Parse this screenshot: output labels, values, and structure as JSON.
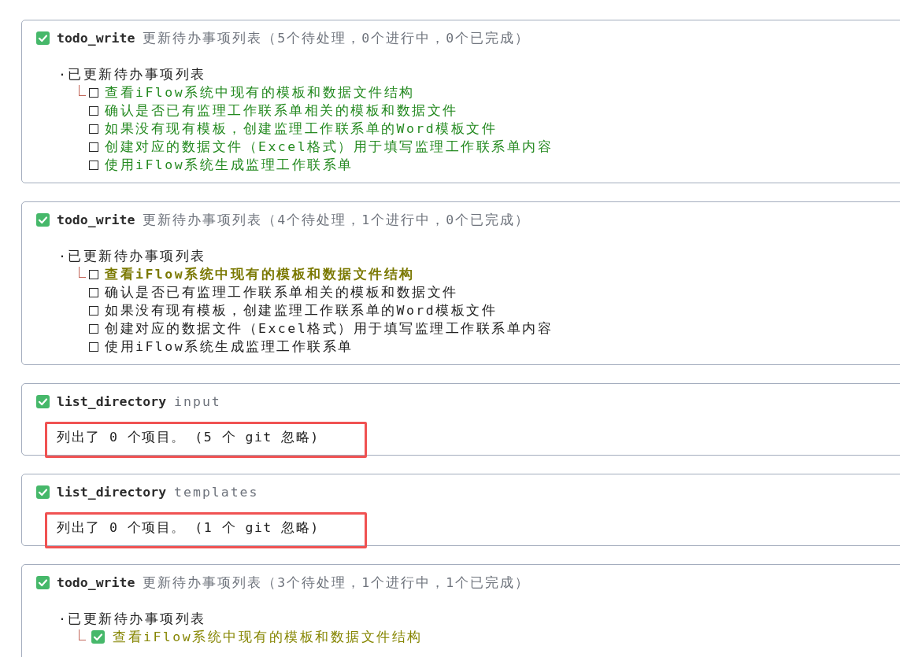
{
  "cards": [
    {
      "kind": "todo",
      "done": true,
      "tool": "todo_write",
      "description": "更新待办事项列表（5个待处理，0个进行中，0个已完成）",
      "summary": "·已更新待办事项列表",
      "items": [
        {
          "text": "查看iFlow系统中现有的模板和数据文件结构",
          "checked": false,
          "active": false,
          "color": "#23891f"
        },
        {
          "text": "确认是否已有监理工作联系单相关的模板和数据文件",
          "checked": false,
          "active": false,
          "color": "#23891f"
        },
        {
          "text": "如果没有现有模板，创建监理工作联系单的Word模板文件",
          "checked": false,
          "active": false,
          "color": "#23891f"
        },
        {
          "text": "创建对应的数据文件（Excel格式）用于填写监理工作联系单内容",
          "checked": false,
          "active": false,
          "color": "#23891f"
        },
        {
          "text": "使用iFlow系统生成监理工作联系单",
          "checked": false,
          "active": false,
          "color": "#23891f"
        }
      ]
    },
    {
      "kind": "todo",
      "done": true,
      "tool": "todo_write",
      "description": "更新待办事项列表（4个待处理，1个进行中，0个已完成）",
      "summary": "·已更新待办事项列表",
      "items": [
        {
          "text": "查看iFlow系统中现有的模板和数据文件结构",
          "checked": false,
          "active": true,
          "color": "#7a7800"
        },
        {
          "text": "确认是否已有监理工作联系单相关的模板和数据文件",
          "checked": false,
          "active": false,
          "color": "#222222"
        },
        {
          "text": "如果没有现有模板，创建监理工作联系单的Word模板文件",
          "checked": false,
          "active": false,
          "color": "#222222"
        },
        {
          "text": "创建对应的数据文件（Excel格式）用于填写监理工作联系单内容",
          "checked": false,
          "active": false,
          "color": "#222222"
        },
        {
          "text": "使用iFlow系统生成监理工作联系单",
          "checked": false,
          "active": false,
          "color": "#222222"
        }
      ]
    },
    {
      "kind": "listing",
      "done": true,
      "tool": "list_directory",
      "description": "input",
      "result": "列出了 0 个项目。 (5 个 git 忽略)",
      "highlighted": true
    },
    {
      "kind": "listing",
      "done": true,
      "tool": "list_directory",
      "description": "templates",
      "result": "列出了 0 个项目。 (1 个 git 忽略)",
      "highlighted": true
    },
    {
      "kind": "todo",
      "done": true,
      "tool": "todo_write",
      "description": "更新待办事项列表（3个待处理，1个进行中，1个已完成）",
      "summary": "·已更新待办事项列表",
      "items": [
        {
          "text": "查看iFlow系统中现有的模板和数据文件结构",
          "checked": true,
          "active": false,
          "color": "#858500"
        }
      ]
    }
  ]
}
